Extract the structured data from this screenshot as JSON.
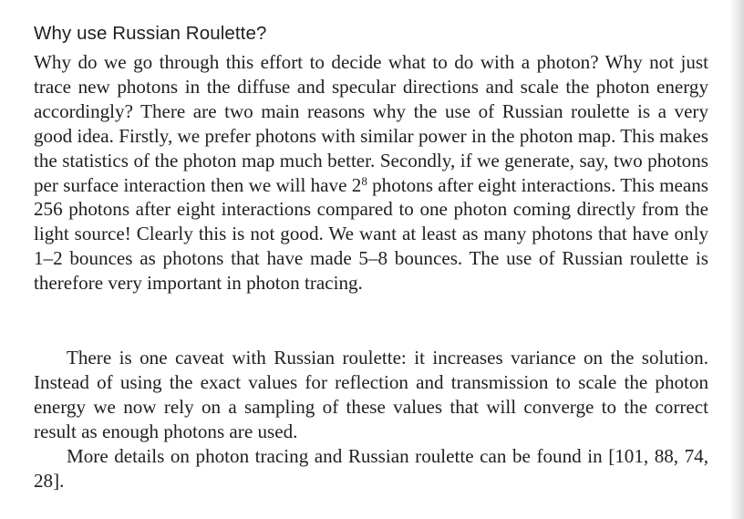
{
  "section": {
    "heading": "Why use Russian Roulette?",
    "paragraph1": {
      "text_before_superscript": "Why do we go through this effort to decide what to do with a photon? Why not just trace new photons in the diffuse and specular directions and scale the photon energy accordingly? There are two main reasons why the use of Russian roulette is a very good idea. Firstly, we prefer photons with similar power in the photon map. This makes the statistics of the photon map much better. Secondly, if we generate, say, two photons per surface interaction then we will have 2",
      "superscript": "8",
      "text_after_superscript": " photons after eight interactions. This means 256 photons after eight interactions compared to one photon coming directly from the light source! Clearly this is not good. We want at least as many photons that have only 1–2 bounces as photons that have made 5–8 bounces. The use of Russian roulette is therefore very important in photon tracing."
    },
    "paragraph2": "There is one caveat with Russian roulette: it increases variance on the solution. Instead of using the exact values for reflection and transmission to scale the photon energy we now rely on a sampling of these values that will converge to the correct result as enough photons are used.",
    "paragraph3": "More details on photon tracing and Russian roulette can be found in [101, 88, 74, 28]."
  }
}
